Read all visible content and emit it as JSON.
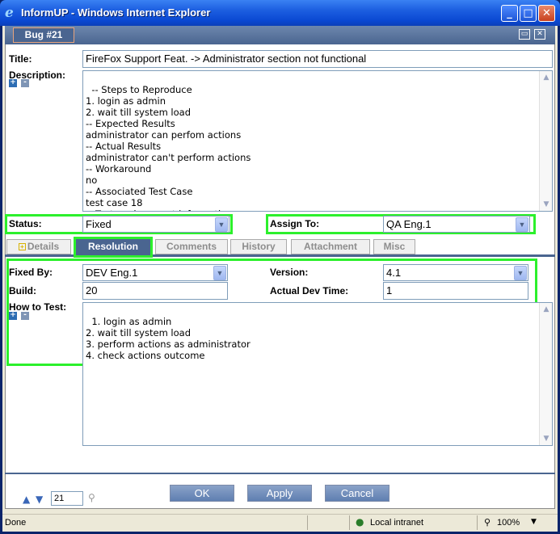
{
  "window": {
    "title": "InformUP - Windows Internet Explorer",
    "minimize": "_",
    "maximize": "□",
    "close": "✕"
  },
  "header": {
    "bug_tab": "Bug #21"
  },
  "form": {
    "title_label": "Title:",
    "title_value": "FireFox Support Feat. -> Administrator section not functional",
    "description_label": "Description:",
    "description_value": "-- Steps to Reproduce\n1. login as admin\n2. wait till system load\n-- Expected Results\nadministrator can perfom actions\n-- Actual Results\nadministrator can't perform actions\n-- Workaround\nno\n-- Associated Test Case\ntest case 18\n-- Test environment information",
    "status_label": "Status:",
    "status_value": "Fixed",
    "assign_label": "Assign To:",
    "assign_value": "QA Eng.1"
  },
  "tabs": [
    {
      "label": "Details"
    },
    {
      "label": "Resolution"
    },
    {
      "label": "Comments"
    },
    {
      "label": "History"
    },
    {
      "label": "Attachment"
    },
    {
      "label": "Misc"
    }
  ],
  "resolution": {
    "fixed_by_label": "Fixed By:",
    "fixed_by_value": "DEV Eng.1",
    "version_label": "Version:",
    "version_value": "4.1",
    "build_label": "Build:",
    "build_value": "20",
    "actual_dev_time_label": "Actual Dev Time:",
    "actual_dev_time_value": "1",
    "how_to_test_label": "How to Test:",
    "how_to_test_value": "1. login as admin\n2. wait till system load\n3. perform actions as administrator\n4. check actions outcome"
  },
  "footer": {
    "page_number": "21",
    "ok": "OK",
    "apply": "Apply",
    "cancel": "Cancel"
  },
  "statusbar": {
    "status": "Done",
    "zone": "Local intranet",
    "zoom": "100%"
  }
}
